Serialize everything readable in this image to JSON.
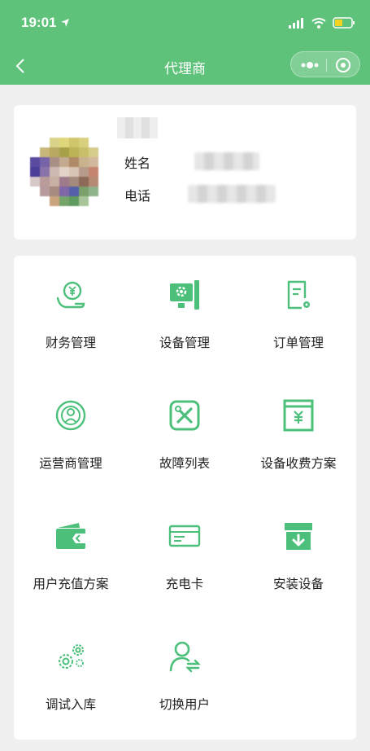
{
  "status": {
    "time": "19:01"
  },
  "nav": {
    "title": "代理商"
  },
  "profile": {
    "name_label": "姓名",
    "phone_label": "电话"
  },
  "menu": [
    {
      "label": "财务管理",
      "icon": "finance-icon"
    },
    {
      "label": "设备管理",
      "icon": "device-icon"
    },
    {
      "label": "订单管理",
      "icon": "order-icon"
    },
    {
      "label": "运营商管理",
      "icon": "operator-icon"
    },
    {
      "label": "故障列表",
      "icon": "fault-icon"
    },
    {
      "label": "设备收费方案",
      "icon": "fee-plan-icon"
    },
    {
      "label": "用户充值方案",
      "icon": "wallet-icon"
    },
    {
      "label": "充电卡",
      "icon": "card-icon"
    },
    {
      "label": "安装设备",
      "icon": "install-icon"
    },
    {
      "label": "调试入库",
      "icon": "gears-icon"
    },
    {
      "label": "切换用户",
      "icon": "switch-user-icon"
    }
  ],
  "colors": {
    "brand": "#5ec27a",
    "icon": "#4cc07a",
    "background": "#f0f0f0"
  }
}
